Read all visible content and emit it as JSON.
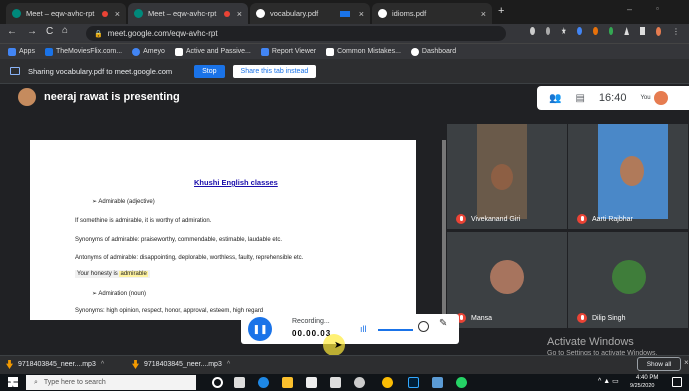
{
  "browser": {
    "tabs": [
      {
        "label": "Meet – eqw-avhc-rpt"
      },
      {
        "label": "Meet – eqw-avhc-rpt"
      },
      {
        "label": "vocabulary.pdf"
      },
      {
        "label": "idioms.pdf"
      }
    ],
    "new_tab": "+",
    "url": "meet.google.com/eqw-avhc-rpt",
    "bookmarks": [
      "Apps",
      "TheMoviesFlix.com...",
      "Ameyo",
      "Active and Passive...",
      "Report Viewer",
      "Common Mistakes...",
      "Dashboard"
    ]
  },
  "share_bar": {
    "text": "Sharing vocabulary.pdf to meet.google.com",
    "stop_label": "Stop",
    "share_tab_label": "Share this tab instead"
  },
  "meet": {
    "presenter": "neeraj rawat is presenting",
    "time": "16:40",
    "you": "You"
  },
  "document": {
    "title": "Khushi English classes",
    "lines": [
      "➢   Admirable (adjective)",
      "If somethine is admirable, it is worthy of admiration.",
      "Synonyms of admirable: praiseworthy, commendable, estimable, laudable etc.",
      "Antonyms of admirable: disappointing, deplorable, worthless, faulty, reprehensible etc.",
      "➢   Admiration (noun)",
      "Synonyms: high opinion, respect, honor, approval, esteem, high regard"
    ],
    "example_prefix": "Your honesty is ",
    "example_highlight": "admirable"
  },
  "participants": [
    {
      "name": "Vivekanand Giri"
    },
    {
      "name": "Aarti Rajbhar"
    },
    {
      "name": "Mansa"
    },
    {
      "name": "Dilip Singh"
    }
  ],
  "recording": {
    "label": "Recording...",
    "time": "00.00.03"
  },
  "watermark": {
    "line1": "Activate Windows",
    "line2": "Go to Settings to activate Windows."
  },
  "downloads": {
    "items": [
      "9718403845_neer....mp3",
      "9718403845_neer....mp3"
    ],
    "show_all": "Show all"
  },
  "taskbar": {
    "search_placeholder": "Type here to search",
    "time": "4:40 PM",
    "date": "9/25/2020"
  }
}
